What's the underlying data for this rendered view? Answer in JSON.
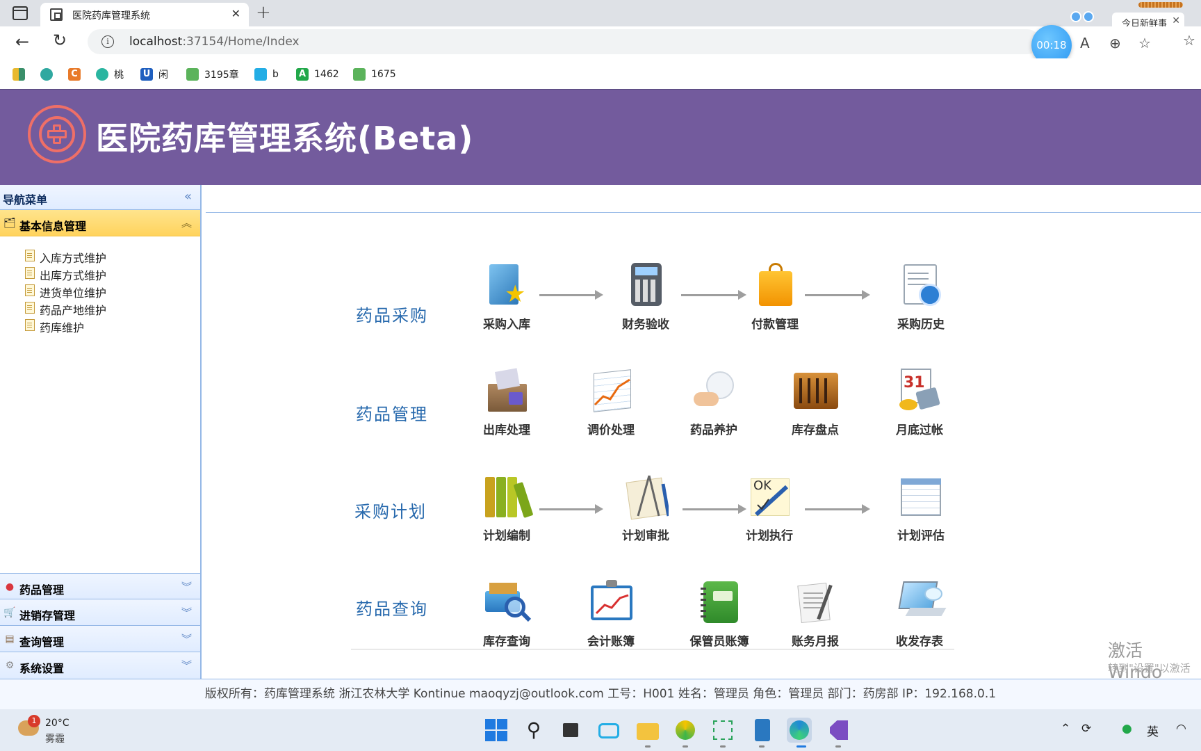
{
  "browser": {
    "tab_title": "医院药库管理系统",
    "url_host": "localhost",
    "url_rest": ":37154/Home/Index",
    "timer": "00:18",
    "news_widget": "今日新鲜事",
    "bookmarks": [
      {
        "label": "",
        "icon": "tile-grid-icon",
        "color": "#3a8f6a"
      },
      {
        "label": "",
        "icon": "gear-flower-icon",
        "color": "#2fa8a0"
      },
      {
        "label": "",
        "icon": "c-logo-icon",
        "color": "#e87a2a"
      },
      {
        "label": "桃",
        "icon": "compass-icon",
        "color": "#2ab5a0"
      },
      {
        "label": "闲",
        "icon": "u-logo-icon",
        "color": "#1f5fbf"
      },
      {
        "label": "3195章",
        "icon": "book-icon",
        "color": "#5bb35b"
      },
      {
        "label": "b",
        "icon": "bilibili-icon",
        "color": "#23ade5"
      },
      {
        "label": "1462",
        "icon": "a-logo-icon",
        "color": "#22a84a"
      },
      {
        "label": "1675",
        "icon": "book-icon",
        "color": "#5bb35b"
      }
    ]
  },
  "app": {
    "title": "医院药库管理系统(Beta)",
    "brand_color": "#735b9d",
    "logo_color": "#ef6f67"
  },
  "sidebar": {
    "title": "导航菜单",
    "active_section": {
      "label": "基本信息管理",
      "items": [
        "入库方式维护",
        "出库方式维护",
        "进货单位维护",
        "药品产地维护",
        "药库维护"
      ]
    },
    "sections": [
      {
        "label": "药品管理",
        "icon": "pill-icon"
      },
      {
        "label": "进销存管理",
        "icon": "cart-icon"
      },
      {
        "label": "查询管理",
        "icon": "ledger-icon"
      },
      {
        "label": "系统设置",
        "icon": "gear-icon"
      }
    ]
  },
  "dashboard": {
    "rows": [
      {
        "label": "药品采购",
        "modules": [
          "采购入库",
          "财务验收",
          "付款管理",
          "采购历史"
        ]
      },
      {
        "label": "药品管理",
        "modules": [
          "出库处理",
          "调价处理",
          "药品养护",
          "库存盘点",
          "月底过帐"
        ]
      },
      {
        "label": "采购计划",
        "modules": [
          "计划编制",
          "计划审批",
          "计划执行",
          "计划评估"
        ]
      },
      {
        "label": "药品查询",
        "modules": [
          "库存查询",
          "会计账簿",
          "保管员账簿",
          "账务月报",
          "收发存表"
        ]
      }
    ]
  },
  "watermark": {
    "line1": "激活 Windo",
    "line2": "转到\"设置\"以激活"
  },
  "footer": {
    "text": "版权所有：药库管理系统 浙江农林大学 Kontinue maoqyzj@outlook.com 工号：H001 姓名：管理员 角色：管理员 部门：药房部 IP：192.168.0.1"
  },
  "taskbar": {
    "weather_temp": "20°C",
    "weather_desc": "雾霾",
    "weather_badge": "1",
    "ime": "英"
  }
}
